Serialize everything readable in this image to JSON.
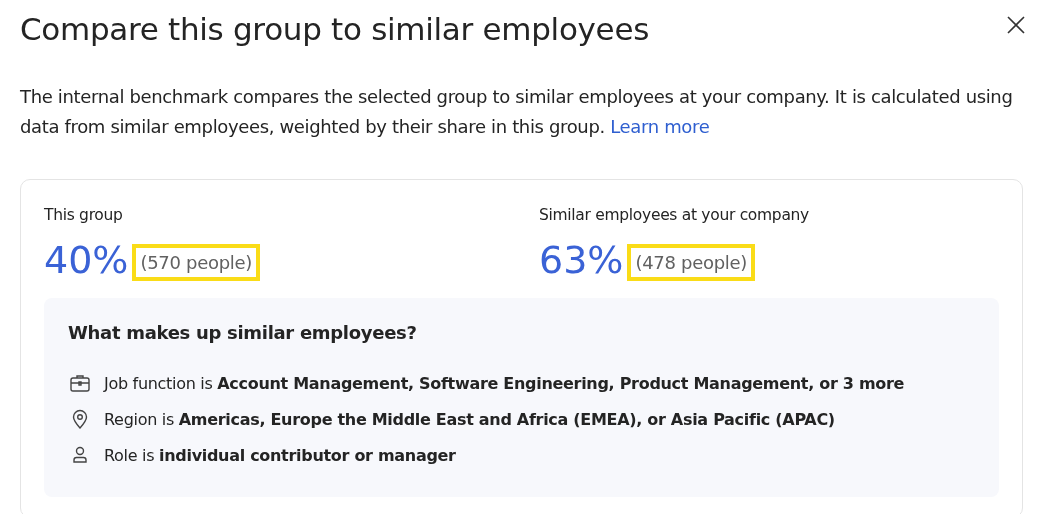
{
  "dialog": {
    "title": "Compare this group to similar employees",
    "description": "The internal benchmark compares the selected group to similar employees at your company. It is calculated using data from similar employees, weighted by their share in this group.",
    "link": "Learn more"
  },
  "metrics": [
    {
      "label": "This group",
      "value": "40%",
      "count": "(570 people)",
      "highlighted": true
    },
    {
      "label": "Similar employees at your company",
      "value": "63%",
      "count": "(478 people)",
      "highlighted": true
    }
  ],
  "breakdown": {
    "heading": "What makes up similar employees?",
    "items": [
      {
        "kind": "job",
        "text": "Job function is **Account Management, Software Engineering, Product Management, or 3 more**"
      },
      {
        "kind": "region",
        "text": "Region is **Americas, Europe the Middle East and Africa (EMEA), or Asia Pacific (APAC)**"
      },
      {
        "kind": "role",
        "text": "Role is **individual contributor or manager**"
      }
    ]
  }
}
